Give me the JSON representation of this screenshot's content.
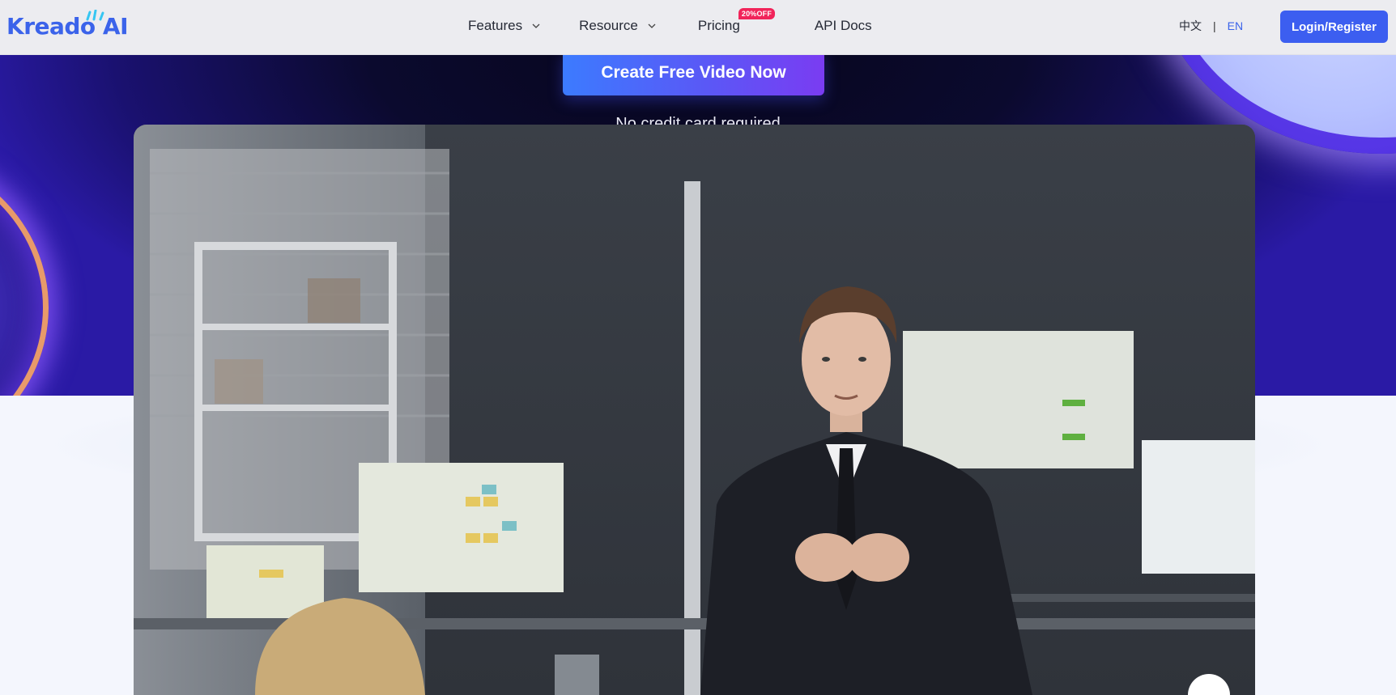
{
  "header": {
    "logo_text": "Kreado AI",
    "nav": [
      {
        "label": "Features",
        "has_dropdown": true
      },
      {
        "label": "Resource",
        "has_dropdown": true
      },
      {
        "label": "Pricing",
        "badge": "20%OFF"
      },
      {
        "label": "API Docs"
      }
    ],
    "lang": {
      "zh": "中文",
      "separator": "|",
      "en": "EN"
    },
    "login_label": "Login/Register"
  },
  "hero": {
    "cta_label": "Create Free Video Now",
    "subtext": "No credit card required"
  },
  "colors": {
    "brand": "#3c5ef0",
    "badge": "#f1245a",
    "hero_dark": "#0b0a2e",
    "accent_purple": "#5636e6"
  },
  "icons": [
    "chevron-down-icon",
    "logo-icon"
  ]
}
